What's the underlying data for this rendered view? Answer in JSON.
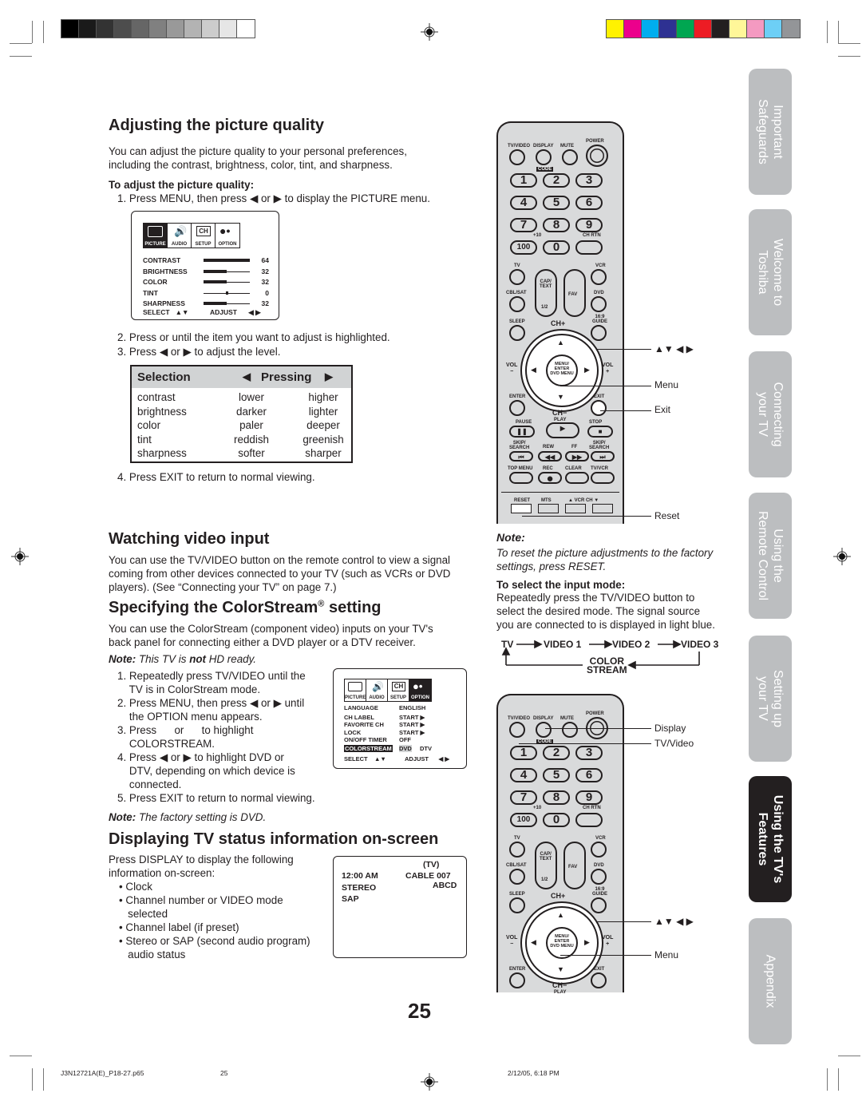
{
  "color_bars": {
    "gray": [
      "#000000",
      "#1a1a1a",
      "#333333",
      "#4d4d4d",
      "#666666",
      "#808080",
      "#999999",
      "#b3b3b3",
      "#cccccc",
      "#e6e6e6",
      "#ffffff"
    ],
    "color": [
      "#fff200",
      "#ec008c",
      "#00aeef",
      "#2e3192",
      "#00a651",
      "#ed1c24",
      "#231f20",
      "#fff799",
      "#f49ac1",
      "#6dcff6",
      "#939598"
    ]
  },
  "adjust_section": {
    "title": "Adjusting the picture quality",
    "intro_line1": "You can adjust the picture quality to your personal preferences,",
    "intro_line2": "including the contrast, brightness, color, tint, and sharpness.",
    "subheading": "To adjust the picture quality:",
    "step1": "1. Press MENU, then press ◀ or ▶ to display the PICTURE menu.",
    "step2": "2. Press      or      until the item you want to adjust is highlighted.",
    "step3": "3. Press ◀ or ▶ to adjust the level.",
    "step4": "4. Press EXIT to return to normal viewing."
  },
  "picture_menu": {
    "tabs": [
      "PICTURE",
      "AUDIO",
      "SETUP",
      "OPTION"
    ],
    "setup_icon_text": "CH",
    "active_tab": "PICTURE",
    "items": [
      {
        "label": "CONTRAST",
        "value": "64",
        "level": 1.0
      },
      {
        "label": "BRIGHTNESS",
        "value": "32",
        "level": 0.5
      },
      {
        "label": "COLOR",
        "value": "32",
        "level": 0.5
      },
      {
        "label": "TINT",
        "value": "0",
        "level": 0.5
      },
      {
        "label": "SHARPNESS",
        "value": "32",
        "level": 0.5
      }
    ],
    "select_label": "SELECT",
    "select_arrows": "▲▼",
    "adjust_label": "ADJUST",
    "adjust_arrows": "◀ ▶"
  },
  "selection_table": {
    "header_selection": "Selection",
    "header_pressing": "Pressing",
    "left_arrow": "◀",
    "right_arrow": "▶",
    "rows": [
      {
        "item": "contrast",
        "left": "lower",
        "right": "higher"
      },
      {
        "item": "brightness",
        "left": "darker",
        "right": "lighter"
      },
      {
        "item": "color",
        "left": "paler",
        "right": "deeper"
      },
      {
        "item": "tint",
        "left": "reddish",
        "right": "greenish"
      },
      {
        "item": "sharpness",
        "left": "softer",
        "right": "sharper"
      }
    ]
  },
  "video_input_section": {
    "title": "Watching video input",
    "line1": "You can use the TV/VIDEO button on the remote control to view a signal",
    "line2": "coming from other devices connected to your TV (such as VCRs or DVD",
    "line3": "players). (See “Connecting your TV” on page 7.)"
  },
  "colorstream_section": {
    "title": "Specifying the ColorStream",
    "title_sup": "®",
    "title_end": " setting",
    "line1": "You can use the ColorStream (component video) inputs on your TV's",
    "line2": "back panel for connecting either a DVD player or a DTV receiver.",
    "note_label": "Note:",
    "note_a": " This TV is ",
    "note_b": "not",
    "note_c": " HD ready.",
    "steps": [
      "1. Repeatedly press TV/VIDEO until the",
      "    TV is in ColorStream mode.",
      "2. Press MENU, then press ◀ or ▶ until",
      "    the OPTION menu appears.",
      "3. Press      or      to highlight",
      "    COLORSTREAM.",
      "4. Press ◀ or ▶ to highlight DVD or",
      "    DTV, depending on which device is",
      "    connected.",
      "5. Press EXIT to return to normal viewing."
    ],
    "note2_label": "Note:",
    "note2_text": " The factory setting is DVD."
  },
  "option_menu": {
    "tabs": [
      "PICTURE",
      "AUDIO",
      "SETUP",
      "OPTION"
    ],
    "active_tab": "OPTION",
    "rows": [
      {
        "label": "LANGUAGE",
        "value": "ENGLISH"
      },
      {
        "label": "CH LABEL",
        "value": "START ▶"
      },
      {
        "label": "FAVORITE CH",
        "value": "START ▶"
      },
      {
        "label": "LOCK",
        "value": "START ▶"
      },
      {
        "label": "ON/OFF TIMER",
        "value": "OFF"
      },
      {
        "label": "COLORSTREAM",
        "value": "DVD",
        "alt": "DTV",
        "highlighted": true
      }
    ],
    "select_label": "SELECT",
    "select_arrows": "▲▼",
    "adjust_label": "ADJUST",
    "adjust_arrows": "◀ ▶"
  },
  "status_section": {
    "title": "Displaying TV status information on-screen",
    "line1": "Press DISPLAY to display the following",
    "line2": "information on-screen:",
    "bullets": [
      "• Clock",
      "• Channel number or VIDEO mode",
      "   selected",
      "• Channel label (if preset)",
      "• Stereo or SAP (second audio program)",
      "   audio status"
    ]
  },
  "display_screen": {
    "tv": "(TV)",
    "time": "12:00 AM",
    "channel": "CABLE  007",
    "label": "ABCD",
    "stereo": "STEREO",
    "sap": "SAP"
  },
  "remote": {
    "top_labels": [
      "TV/VIDEO",
      "DISPLAY",
      "MUTE",
      "POWER"
    ],
    "code_label": "CODE",
    "digits": [
      "1",
      "2",
      "3",
      "4",
      "5",
      "6",
      "7",
      "8",
      "9",
      "100",
      "0",
      ""
    ],
    "plus10": "+10",
    "chrtn": "CH RTN",
    "tv": "TV",
    "vcr": "VCR",
    "cblsat": "CBL/SAT",
    "dvd": "DVD",
    "cap": "CAP/\nTEXT",
    "half": "1/2",
    "fav": "FAV",
    "sleep": "SLEEP",
    "guide": "16:9\nGUIDE",
    "chplus": "CH+",
    "chminus": "CH−",
    "vol_left": "VOL\n−",
    "vol_right": "VOL\n+",
    "menu_center": "MENU/\nENTER\nDVD MENU",
    "enter": "ENTER",
    "exit": "EXIT",
    "play": "PLAY",
    "pause": "PAUSE",
    "stop": "STOP",
    "skip_l": "SKIP/\nSEARCH",
    "rew": "REW",
    "ff": "FF",
    "skip_r": "SKIP/\nSEARCH",
    "topmenu": "TOP MENU",
    "rec": "REC",
    "clear": "CLEAR",
    "tvvcr": "TV/VCR",
    "reset": "RESET",
    "mts": "MTS",
    "vcrch": "▲ VCR CH ▼"
  },
  "callouts": {
    "arrows": "▲▼ ◀ ▶",
    "menu": "Menu",
    "exit": "Exit",
    "reset": "Reset",
    "display": "Display",
    "tvvideo": "TV/Video",
    "arrows2": "▲▼ ◀ ▶",
    "menu2": "Menu"
  },
  "right_note": {
    "label": "Note:",
    "line1": "To reset the picture adjustments to the factory",
    "line2": "settings, press RESET.",
    "sub": "To select the input mode:",
    "body1": "Repeatedly press the TV/VIDEO button to",
    "body2": "select the desired mode. The signal source",
    "body3": "you are connected to is displayed in light blue."
  },
  "input_flow": {
    "nodes": [
      "TV",
      "VIDEO 1",
      "VIDEO 2",
      "VIDEO 3"
    ],
    "return_node": "COLOR\nSTREAM"
  },
  "side_tabs": [
    {
      "label": "Important\nSafeguards",
      "active": false
    },
    {
      "label": "Welcome to\nToshiba",
      "active": false
    },
    {
      "label": "Connecting\nyour TV",
      "active": false
    },
    {
      "label": "Using the\nRemote Control",
      "active": false
    },
    {
      "label": "Setting up\nyour TV",
      "active": false
    },
    {
      "label": "Using the TV's\nFeatures",
      "active": true
    },
    {
      "label": "Appendix",
      "active": false
    }
  ],
  "page_number": "25",
  "footer": {
    "file": "J3N12721A(E)_P18-27.p65",
    "page": "25",
    "date": "2/12/05, 6:18 PM"
  }
}
